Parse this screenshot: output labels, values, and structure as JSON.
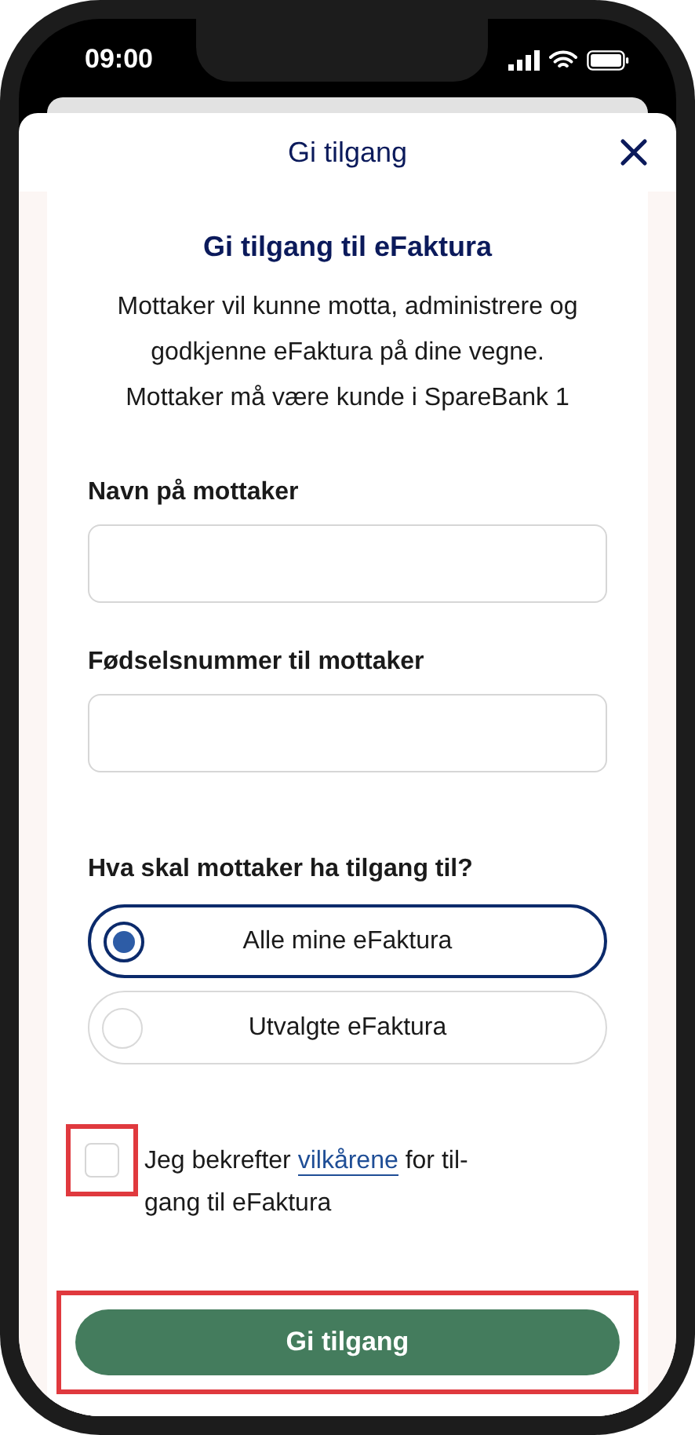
{
  "status_bar": {
    "time": "09:00"
  },
  "header": {
    "title": "Gi tilgang"
  },
  "intro": {
    "heading": "Gi tilgang til eFaktura",
    "text": "Mottaker vil kunne motta, administrere og godkjenne eFaktura på dine vegne. Mottaker må være kunde i SpareBank 1"
  },
  "fields": [
    {
      "label": "Navn på mottaker"
    },
    {
      "label": "Fødselsnummer til mottaker"
    }
  ],
  "access": {
    "question": "Hva skal mottaker ha tilgang til?",
    "options": [
      {
        "label": "Alle mine eFaktura",
        "selected": true
      },
      {
        "label": "Utvalgte eFaktura",
        "selected": false
      }
    ]
  },
  "consent": {
    "checked": false,
    "highlighted": true,
    "text_before": "Jeg bekrefter",
    "link": "vilkårene",
    "text_after": "for til-",
    "text_line2": "gang til eFaktura"
  },
  "submit": {
    "label": "Gi tilgang",
    "highlighted": true
  }
}
